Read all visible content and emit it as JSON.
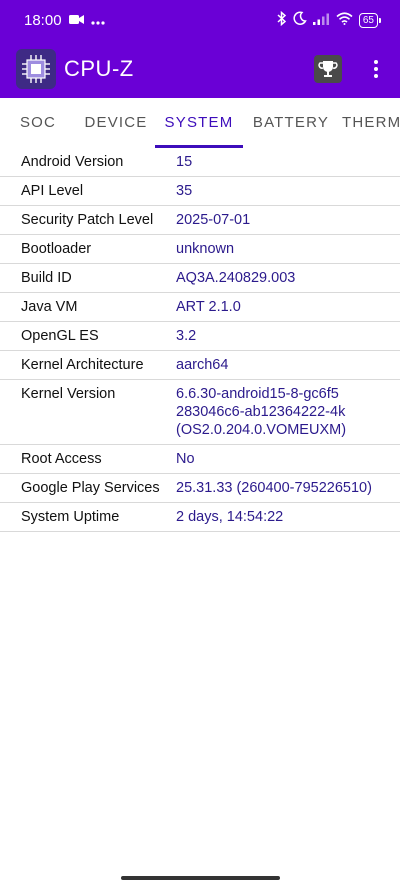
{
  "status_bar": {
    "time": "18:00",
    "battery_level": "65"
  },
  "app": {
    "title": "CPU-Z"
  },
  "tabs": [
    {
      "label": "SOC",
      "active": false
    },
    {
      "label": "DEVICE",
      "active": false
    },
    {
      "label": "SYSTEM",
      "active": true
    },
    {
      "label": "BATTERY",
      "active": false
    },
    {
      "label": "THERMAL",
      "active": false
    }
  ],
  "system_info": [
    {
      "label": "Android Version",
      "value": "15"
    },
    {
      "label": "API Level",
      "value": "35"
    },
    {
      "label": "Security Patch Level",
      "value": "2025-07-01"
    },
    {
      "label": "Bootloader",
      "value": "unknown"
    },
    {
      "label": "Build ID",
      "value": "AQ3A.240829.003"
    },
    {
      "label": "Java VM",
      "value": "ART 2.1.0"
    },
    {
      "label": "OpenGL ES",
      "value": "3.2"
    },
    {
      "label": "Kernel Architecture",
      "value": "aarch64"
    },
    {
      "label": "Kernel Version",
      "value_lines": [
        "6.6.30-android15-8-gc6f5",
        "283046c6-ab12364222-4k",
        "(OS2.0.204.0.VOMEUXM)"
      ]
    },
    {
      "label": "Root Access",
      "value": "No"
    },
    {
      "label": "Google Play Services",
      "value": "25.31.33 (260400-795226510)"
    },
    {
      "label": "System Uptime",
      "value": "2 days, 14:54:22"
    }
  ],
  "colors": {
    "primary": "#6a00d6",
    "accent": "#3d0dbb",
    "value_text": "#2b1a8c"
  }
}
